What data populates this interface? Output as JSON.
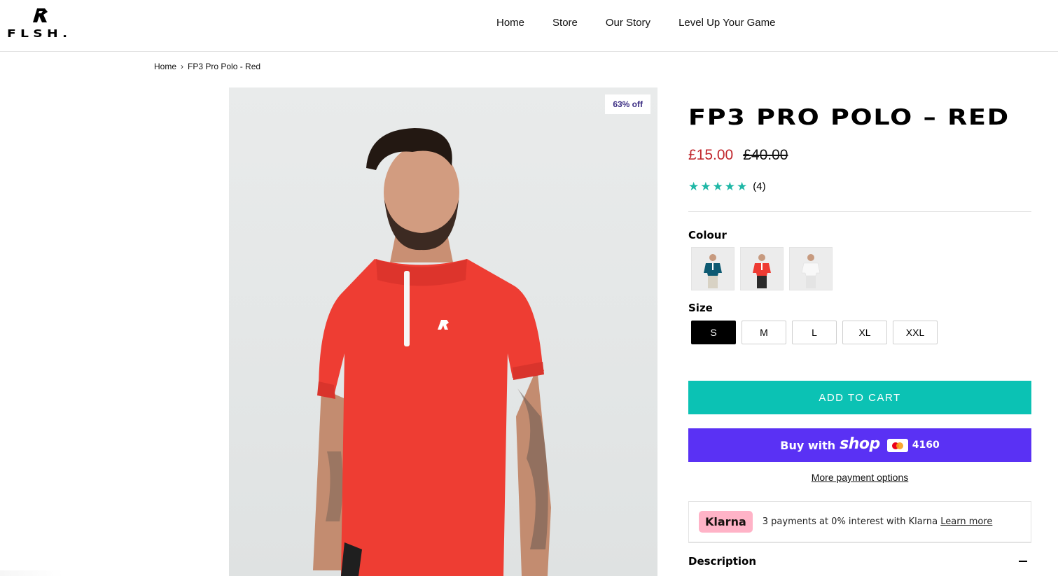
{
  "header": {
    "logo_text": "FLSH.",
    "nav": [
      "Home",
      "Store",
      "Our Story",
      "Level Up Your Game"
    ]
  },
  "breadcrumb": {
    "home": "Home",
    "separator": "›",
    "current": "FP3 Pro Polo - Red"
  },
  "product": {
    "badge": "63% off",
    "title": "FP3 PRO POLO – RED",
    "price_sale": "£15.00",
    "price_original": "£40.00",
    "rating_stars": 5,
    "review_count": "(4)",
    "colour_label": "Colour",
    "colours": [
      {
        "name": "teal",
        "shirt": "#0e5a72",
        "pants": "#d8d2c4"
      },
      {
        "name": "red",
        "shirt": "#ee3b33",
        "pants": "#2b2b2b"
      },
      {
        "name": "white",
        "shirt": "#f4f4f4",
        "pants": "#e4e4e4"
      }
    ],
    "size_label": "Size",
    "sizes": [
      "S",
      "M",
      "L",
      "XL",
      "XXL"
    ],
    "selected_size": "S",
    "add_to_cart": "ADD TO CART",
    "shop_pay": {
      "buy_with": "Buy with",
      "brand": "shop",
      "card_last4": "4160"
    },
    "more_payment": "More payment options",
    "klarna": {
      "logo": "Klarna",
      "text": "3 payments at 0% interest with Klarna",
      "link": "Learn more"
    },
    "description_label": "Description"
  },
  "colors": {
    "accent_teal": "#0bc2b4",
    "shop_purple": "#5a31f4",
    "sale_red": "#c1272d",
    "star_teal": "#1fb7a6"
  }
}
